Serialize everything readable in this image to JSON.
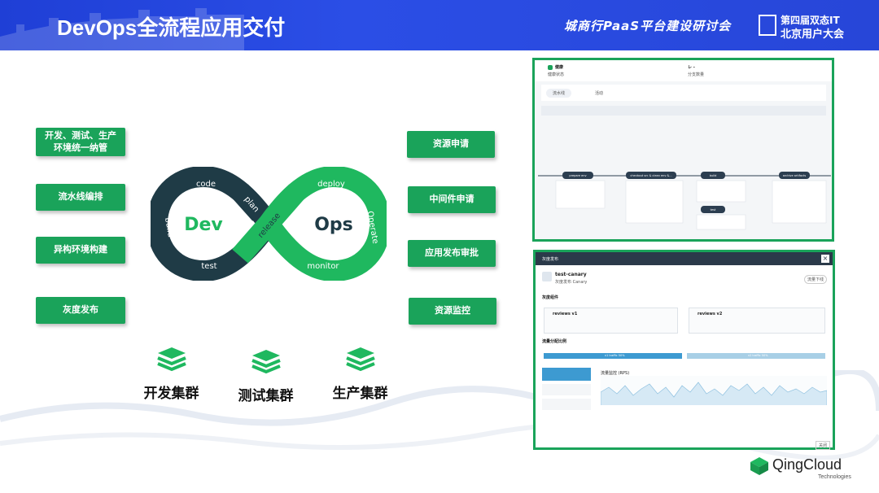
{
  "header": {
    "title": "DevOps全流程应用交付",
    "event": "城商行PaaS平台建设研讨会",
    "conference_line1": "第四届双态IT",
    "conference_line2": "北京用户大会"
  },
  "left_buttons": [
    {
      "label": "开发、测试、生产环境统一纳管"
    },
    {
      "label": "流水线编排"
    },
    {
      "label": "异构环境构建"
    },
    {
      "label": "灰度发布"
    }
  ],
  "right_buttons": [
    {
      "label": "资源申请"
    },
    {
      "label": "中间件申请"
    },
    {
      "label": "应用发布审批"
    },
    {
      "label": "资源监控"
    }
  ],
  "devops_loop": {
    "dev": "Dev",
    "ops": "Ops",
    "stages": [
      "code",
      "build",
      "test",
      "plan",
      "release",
      "deploy",
      "Operate",
      "monitor"
    ]
  },
  "clusters": [
    {
      "label": "开发集群"
    },
    {
      "label": "测试集群"
    },
    {
      "label": "生产集群"
    }
  ],
  "pipeline_shot": {
    "status": "健康",
    "status_sub": "健康状态",
    "branch": "レ -",
    "branch_sub": "分支数量",
    "tabs": [
      "流水线",
      "活动"
    ],
    "stages": [
      "prepare env",
      "checkout src & clean env &...",
      "build",
      "test",
      "archive artifacts"
    ]
  },
  "canary_shot": {
    "dialog_title": "灰度发布",
    "name": "test-canary",
    "name_sub": "灰度发布 Canary",
    "action_button": "流量下线",
    "section1": "灰度组件",
    "version_a": "reviews v1",
    "version_b": "reviews v2",
    "section2": "流量分配比例",
    "bar_a": "v1 traffic 50%",
    "bar_b": "v2 traffic 50%",
    "chart_title": "流量监控 (RPS)",
    "close_button": "关闭"
  },
  "footer_logo": {
    "name": "QingCloud",
    "sub": "Technologies"
  },
  "colors": {
    "header_blue": "#2746d8",
    "brand_green": "#1aa35a",
    "loop_dark": "#1f3b46",
    "loop_green": "#1fb85f"
  }
}
